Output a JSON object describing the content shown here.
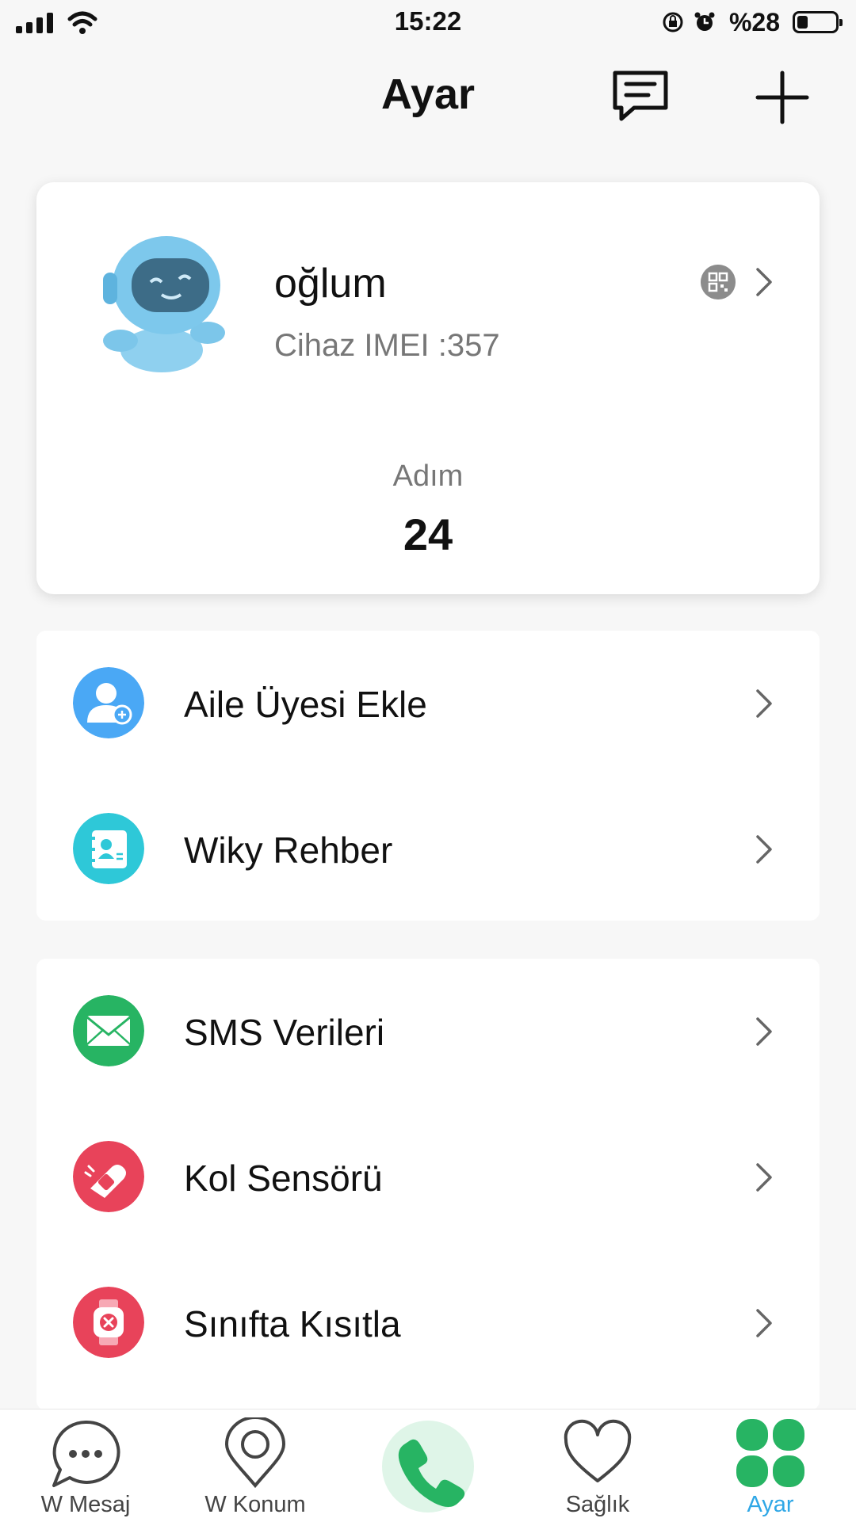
{
  "status_bar": {
    "time": "15:22",
    "battery_text": "%28",
    "battery_level": 0.28
  },
  "header": {
    "title": "Ayar",
    "message_icon": "message-square-icon",
    "add_icon": "plus-icon"
  },
  "device": {
    "name": "oğlum",
    "imei": "Cihaz IMEI :357",
    "steps_label": "Adım",
    "steps_value": "24",
    "avatar_icon": "robot-avatar-icon",
    "qr_icon": "qr-code-icon"
  },
  "menu": {
    "group1": [
      {
        "label": "Aile Üyesi Ekle",
        "icon": "add-family-member-icon",
        "color": "#4aa8f5"
      },
      {
        "label": "Wiky Rehber",
        "icon": "contacts-book-icon",
        "color": "#2ec8d8"
      }
    ],
    "group2": [
      {
        "label": "SMS Verileri",
        "icon": "envelope-icon",
        "color": "#27b463"
      },
      {
        "label": "Kol Sensörü",
        "icon": "wrist-sensor-icon",
        "color": "#e8435a"
      },
      {
        "label": "Sınıfta Kısıtla",
        "icon": "watch-restrict-icon",
        "color": "#e8435a"
      }
    ]
  },
  "tabs": [
    {
      "label": "W Mesaj",
      "icon": "chat-bubble-icon"
    },
    {
      "label": "W Konum",
      "icon": "location-pin-icon"
    },
    {
      "label": "",
      "icon": "phone-call-icon"
    },
    {
      "label": "Sağlık",
      "icon": "heart-icon"
    },
    {
      "label": "Ayar",
      "icon": "clover-grid-icon",
      "active": true
    }
  ],
  "colors": {
    "accent": "#2fa7e6",
    "green": "#27b463",
    "background": "#f7f7f7"
  }
}
